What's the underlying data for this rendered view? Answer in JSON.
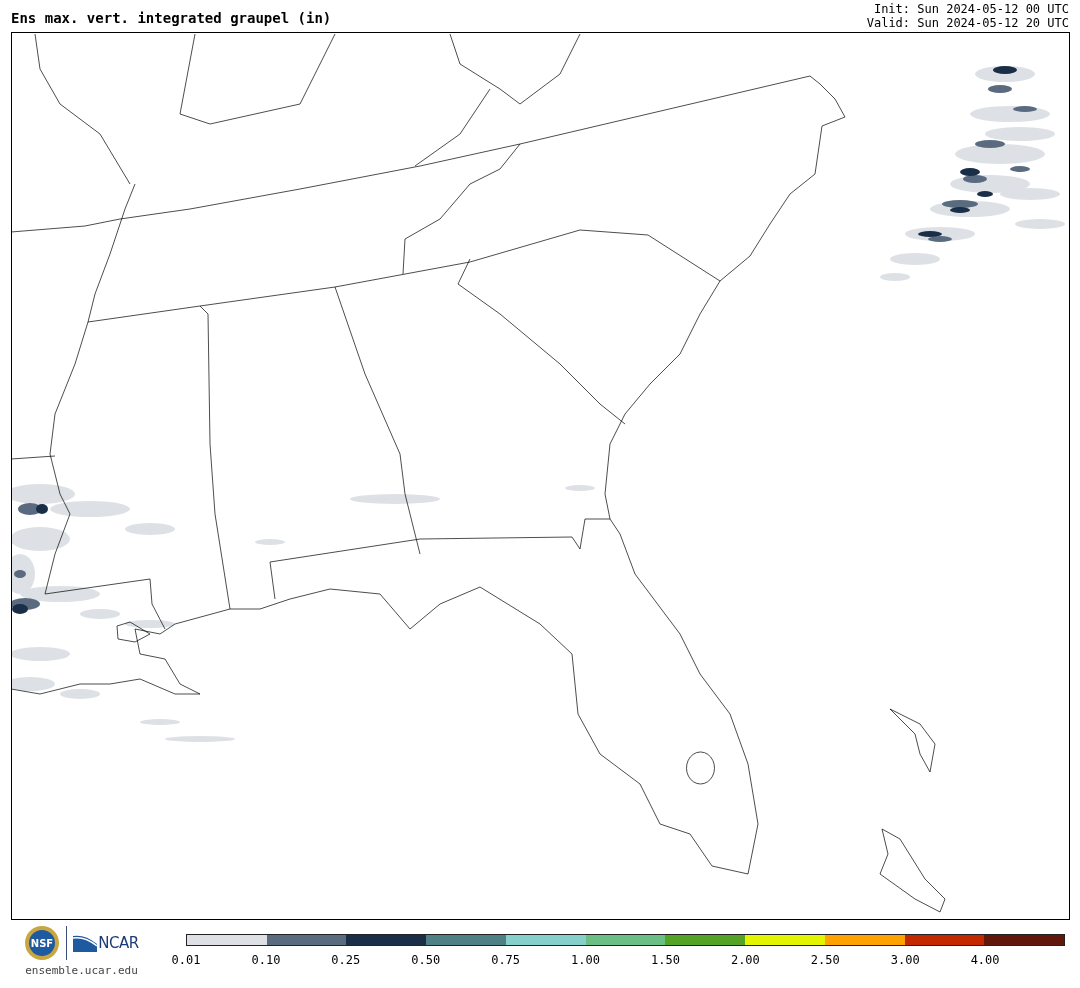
{
  "title": "Ens max. vert. integrated graupel (in)",
  "init": "Init: Sun 2024-05-12 00 UTC",
  "valid": "Valid: Sun 2024-05-12 20 UTC",
  "logos": {
    "nsf_text": "NSF",
    "ncar_text": "NCAR",
    "url": "ensemble.ucar.edu"
  },
  "colorbar": {
    "segments": [
      {
        "color": "#dde1e5"
      },
      {
        "color": "#5a6b80"
      },
      {
        "color": "#1a2e48"
      },
      {
        "color": "#4e8085"
      },
      {
        "color": "#86cfca"
      },
      {
        "color": "#6cbf84"
      },
      {
        "color": "#54a324"
      },
      {
        "color": "#e3f400"
      },
      {
        "color": "#ffa100"
      },
      {
        "color": "#c42800"
      },
      {
        "color": "#62170b"
      }
    ],
    "ticks": [
      "0.01",
      "0.10",
      "0.25",
      "0.50",
      "0.75",
      "1.00",
      "1.50",
      "2.00",
      "2.50",
      "3.00",
      "4.00"
    ]
  }
}
